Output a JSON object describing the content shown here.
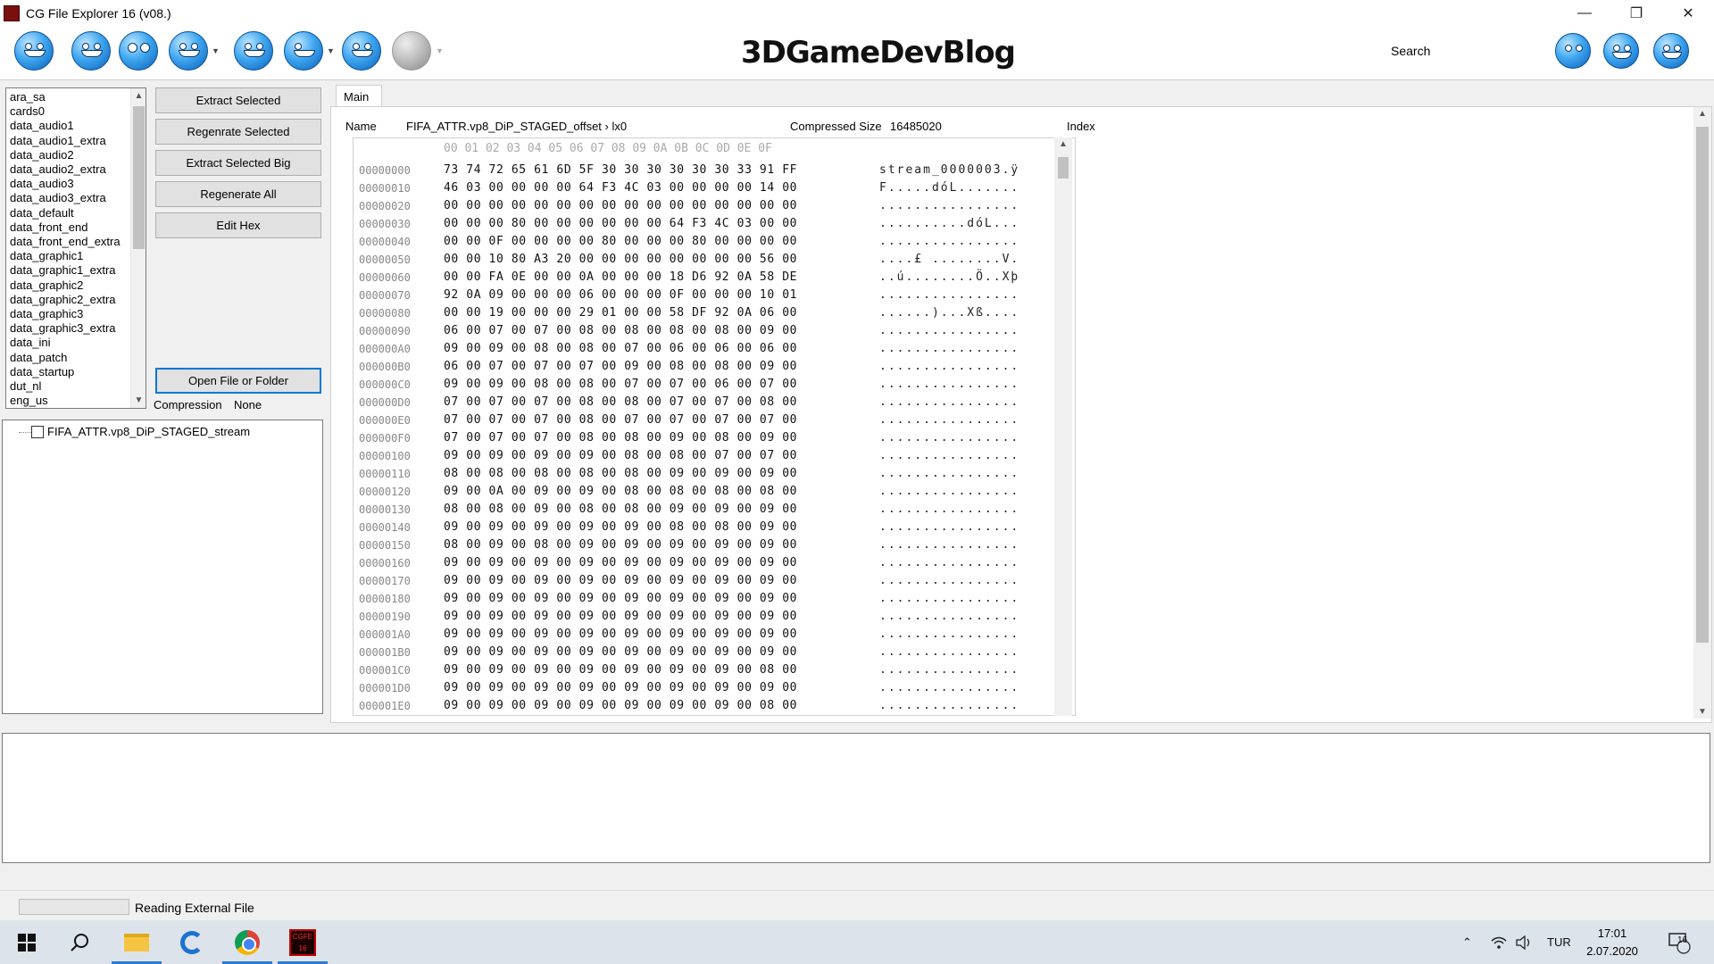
{
  "window": {
    "title": "CG File Explorer 16 (v08.)",
    "minimize": "—",
    "restore": "❐",
    "close": "✕"
  },
  "toolbar": {
    "logo": "3DGameDevBlog",
    "search_label": "Search",
    "search_value": "",
    "icons": [
      "open-smiley-icon",
      "refresh-smiley-icon",
      "eyes-smiley-icon",
      "sad-smiley-icon",
      "happy-smiley-icon",
      "wink-smiley-icon",
      "grin-smiley-icon",
      "disabled-smiley-icon",
      "angry-smiley-icon",
      "crying-smiley-icon",
      "laughing-smiley-icon"
    ]
  },
  "file_list": [
    "ara_sa",
    "cards0",
    "data_audio1",
    "data_audio1_extra",
    "data_audio2",
    "data_audio2_extra",
    "data_audio3",
    "data_audio3_extra",
    "data_default",
    "data_front_end",
    "data_front_end_extra",
    "data_graphic1",
    "data_graphic1_extra",
    "data_graphic2",
    "data_graphic2_extra",
    "data_graphic3",
    "data_graphic3_extra",
    "data_ini",
    "data_patch",
    "data_startup",
    "dut_nl",
    "eng_us"
  ],
  "buttons": {
    "extract_selected": "Extract Selected",
    "regenerate_selected": "Regenrate Selected",
    "extract_selected_big": "Extract Selected Big",
    "regenerate_all": "Regenerate All",
    "edit_hex": "Edit Hex",
    "open_file_or_folder": "Open File or Folder"
  },
  "compression": {
    "label": "Compression",
    "value": "None"
  },
  "tree": {
    "item": "FIFA_ATTR.vp8_DiP_STAGED_stream"
  },
  "main": {
    "tab": "Main",
    "name_label": "Name",
    "name_value": "FIFA_ATTR.vp8_DiP_STAGED_offset › lx0",
    "compressed_size_label": "Compressed Size",
    "compressed_size_value": "16485020",
    "index_label": "Index"
  },
  "hex": {
    "header": "00 01 02 03 04 05 06 07 08 09 0A 0B 0C 0D 0E 0F",
    "rows": [
      {
        "off": "00000000",
        "bytes": "73 74 72 65 61 6D 5F 30 30 30 30 30 30 33 91 FF",
        "ascii": "stream_0000003.ÿ"
      },
      {
        "off": "00000010",
        "bytes": "46 03 00 00 00 00 64 F3 4C 03 00 00 00 00 14 00",
        "ascii": "F.....dóL......."
      },
      {
        "off": "00000020",
        "bytes": "00 00 00 00 00 00 00 00 00 00 00 00 00 00 00 00",
        "ascii": "................"
      },
      {
        "off": "00000030",
        "bytes": "00 00 00 80 00 00 00 00 00 00 64 F3 4C 03 00 00",
        "ascii": "..........dóL..."
      },
      {
        "off": "00000040",
        "bytes": "00 00 0F 00 00 00 00 80 00 00 00 80 00 00 00 00",
        "ascii": "................"
      },
      {
        "off": "00000050",
        "bytes": "00 00 10 80 A3 20 00 00 00 00 00 00 00 00 56 00",
        "ascii": "....£ ........V."
      },
      {
        "off": "00000060",
        "bytes": "00 00 FA 0E 00 00 0A 00 00 00 18 D6 92 0A 58 DE",
        "ascii": "..ú........Ö..Xþ"
      },
      {
        "off": "00000070",
        "bytes": "92 0A 09 00 00 00 06 00 00 00 0F 00 00 00 10 01",
        "ascii": "................"
      },
      {
        "off": "00000080",
        "bytes": "00 00 19 00 00 00 29 01 00 00 58 DF 92 0A 06 00",
        "ascii": "......)...Xß...."
      },
      {
        "off": "00000090",
        "bytes": "06 00 07 00 07 00 08 00 08 00 08 00 08 00 09 00",
        "ascii": "................"
      },
      {
        "off": "000000A0",
        "bytes": "09 00 09 00 08 00 08 00 07 00 06 00 06 00 06 00",
        "ascii": "................"
      },
      {
        "off": "000000B0",
        "bytes": "06 00 07 00 07 00 07 00 09 00 08 00 08 00 09 00",
        "ascii": "................"
      },
      {
        "off": "000000C0",
        "bytes": "09 00 09 00 08 00 08 00 07 00 07 00 06 00 07 00",
        "ascii": "................"
      },
      {
        "off": "000000D0",
        "bytes": "07 00 07 00 07 00 08 00 08 00 07 00 07 00 08 00",
        "ascii": "................"
      },
      {
        "off": "000000E0",
        "bytes": "07 00 07 00 07 00 08 00 07 00 07 00 07 00 07 00",
        "ascii": "................"
      },
      {
        "off": "000000F0",
        "bytes": "07 00 07 00 07 00 08 00 08 00 09 00 08 00 09 00",
        "ascii": "................"
      },
      {
        "off": "00000100",
        "bytes": "09 00 09 00 09 00 09 00 08 00 08 00 07 00 07 00",
        "ascii": "................"
      },
      {
        "off": "00000110",
        "bytes": "08 00 08 00 08 00 08 00 08 00 09 00 09 00 09 00",
        "ascii": "................"
      },
      {
        "off": "00000120",
        "bytes": "09 00 0A 00 09 00 09 00 08 00 08 00 08 00 08 00",
        "ascii": "................"
      },
      {
        "off": "00000130",
        "bytes": "08 00 08 00 09 00 08 00 08 00 09 00 09 00 09 00",
        "ascii": "................"
      },
      {
        "off": "00000140",
        "bytes": "09 00 09 00 09 00 09 00 09 00 08 00 08 00 09 00",
        "ascii": "................"
      },
      {
        "off": "00000150",
        "bytes": "08 00 09 00 08 00 09 00 09 00 09 00 09 00 09 00",
        "ascii": "................"
      },
      {
        "off": "00000160",
        "bytes": "09 00 09 00 09 00 09 00 09 00 09 00 09 00 09 00",
        "ascii": "................"
      },
      {
        "off": "00000170",
        "bytes": "09 00 09 00 09 00 09 00 09 00 09 00 09 00 09 00",
        "ascii": "................"
      },
      {
        "off": "00000180",
        "bytes": "09 00 09 00 09 00 09 00 09 00 09 00 09 00 09 00",
        "ascii": "................"
      },
      {
        "off": "00000190",
        "bytes": "09 00 09 00 09 00 09 00 09 00 09 00 09 00 09 00",
        "ascii": "................"
      },
      {
        "off": "000001A0",
        "bytes": "09 00 09 00 09 00 09 00 09 00 09 00 09 00 09 00",
        "ascii": "................"
      },
      {
        "off": "000001B0",
        "bytes": "09 00 09 00 09 00 09 00 09 00 09 00 09 00 09 00",
        "ascii": "................"
      },
      {
        "off": "000001C0",
        "bytes": "09 00 09 00 09 00 09 00 09 00 09 00 09 00 08 00",
        "ascii": "................"
      },
      {
        "off": "000001D0",
        "bytes": "09 00 09 00 09 00 09 00 09 00 09 00 09 00 09 00",
        "ascii": "................"
      },
      {
        "off": "000001E0",
        "bytes": "09 00 09 00 09 00 09 00 09 00 09 00 09 00 08 00",
        "ascii": "................"
      }
    ]
  },
  "status": {
    "text": "Reading External File",
    "progress": 0.0
  },
  "taskbar": {
    "apps": [
      "start-icon",
      "search-icon",
      "file-explorer-icon",
      "edge-icon",
      "chrome-icon",
      "cg-file-explorer-icon"
    ],
    "cgfe_label": "CGFE 16",
    "language": "TUR",
    "time": "17:01",
    "date": "2.07.2020",
    "notification_count": "16"
  }
}
